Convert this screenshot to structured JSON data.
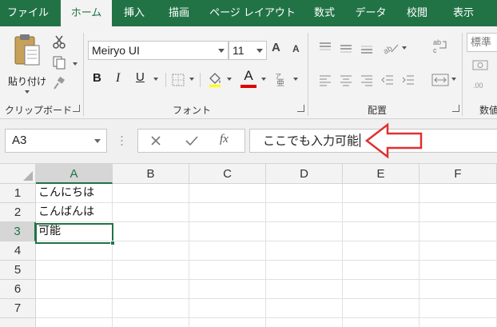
{
  "ribbon_tabs": [
    "ファイル",
    "ホーム",
    "挿入",
    "描画",
    "ページ レイアウト",
    "数式",
    "データ",
    "校閲",
    "表示"
  ],
  "ribbon": {
    "paste_label": "貼り付け",
    "clipboard_label": "クリップボード",
    "font_name": "Meiryo UI",
    "font_size": "11",
    "font_label": "フォント",
    "align_label": "配置",
    "number_format": "標準",
    "number_label": "数値",
    "bold": "B",
    "italic": "I",
    "underline": "U",
    "font_color_letter": "A",
    "grow_font": "A",
    "shrink_font": "A",
    "fx": "fx"
  },
  "colors": {
    "accent": "#217346",
    "font_color": "#e00000",
    "arrow": "#e03030"
  },
  "formula_bar": {
    "name_box": "A3",
    "formula": "ここでも入力可能"
  },
  "grid": {
    "columns": [
      "A",
      "B",
      "C",
      "D",
      "E",
      "F"
    ],
    "rows": [
      "1",
      "2",
      "3",
      "4",
      "5",
      "6",
      "7"
    ],
    "cells": {
      "A1": "こんにちは",
      "A2": "こんばんは",
      "A3": "可能"
    }
  }
}
